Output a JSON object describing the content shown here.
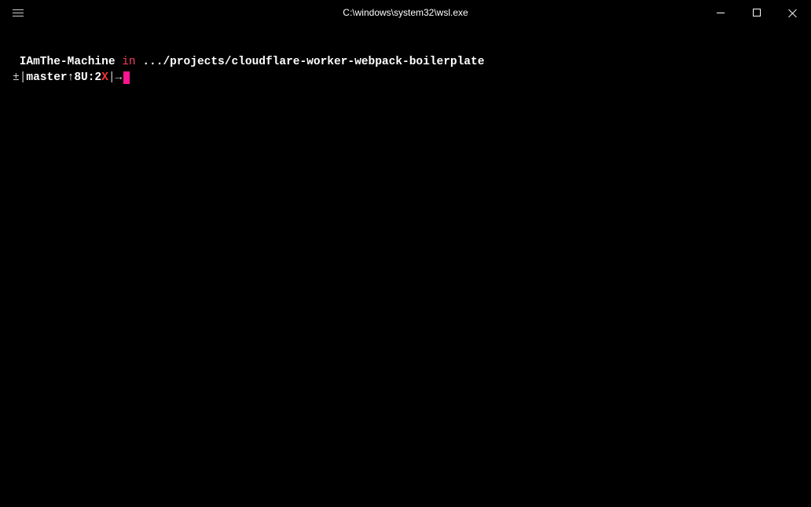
{
  "window": {
    "title": "C:\\windows\\system32\\wsl.exe"
  },
  "prompt": {
    "hostname": "IAmThe-Machine",
    "in_word": "in",
    "path": ".../projects/cloudflare-worker-webpack-boilerplate",
    "git_prefix": "±",
    "branch_open": "|",
    "branch": "master",
    "ahead": "↑8",
    "untracked": "U:2",
    "dirty": "X",
    "branch_close": "|",
    "arrow": "→"
  },
  "colors": {
    "cursor": "#ff1493",
    "error": "#ff3333",
    "keyword": "#f43f5e"
  }
}
